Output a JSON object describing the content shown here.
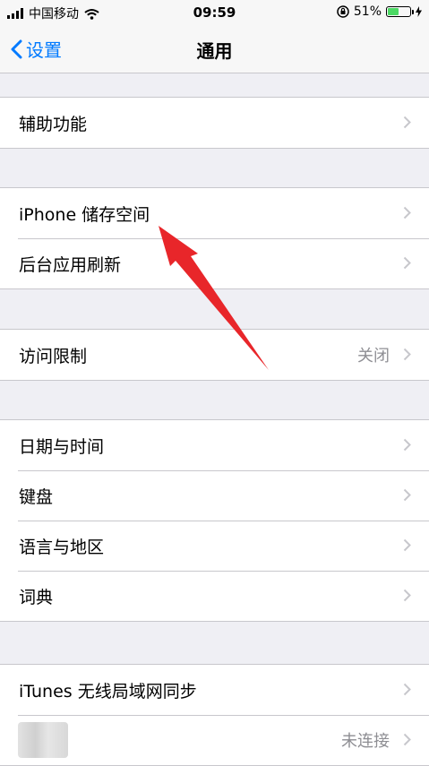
{
  "status_bar": {
    "carrier": "中国移动",
    "time": "09:59",
    "battery": "51%",
    "battery_level": 0.51
  },
  "nav": {
    "back_label": "设置",
    "title": "通用"
  },
  "groups": [
    {
      "items": [
        {
          "label": "辅助功能"
        }
      ]
    },
    {
      "items": [
        {
          "label": "iPhone 储存空间"
        },
        {
          "label": "后台应用刷新"
        }
      ]
    },
    {
      "items": [
        {
          "label": "访问限制",
          "value": "关闭"
        }
      ]
    },
    {
      "items": [
        {
          "label": "日期与时间"
        },
        {
          "label": "键盘"
        },
        {
          "label": "语言与地区"
        },
        {
          "label": "词典"
        }
      ]
    },
    {
      "items": [
        {
          "label": "iTunes 无线局域网同步"
        },
        {
          "label": "",
          "value": "未连接"
        }
      ]
    }
  ],
  "annotation": {
    "color": "#e8262a"
  }
}
